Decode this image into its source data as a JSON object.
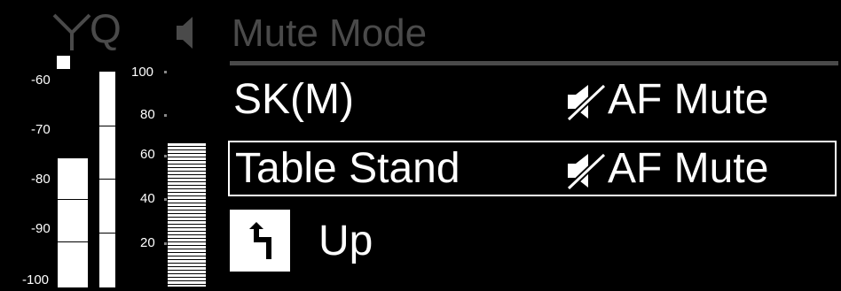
{
  "header": {
    "title": "Mute Mode",
    "icons": [
      "antenna-icon",
      "speaker-icon"
    ],
    "q_label": "Q"
  },
  "meters": {
    "rf_scale": [
      "-60",
      "-70",
      "-80",
      "-90",
      "-100"
    ],
    "af_scale": [
      "100",
      "80",
      "60",
      "40",
      "20"
    ],
    "af_level_percent": 65,
    "rf_level_dbm": -76
  },
  "menu": {
    "items": [
      {
        "label": "SK(M)",
        "value": "AF Mute",
        "value_icon": "muted-speaker-icon",
        "selected": false
      },
      {
        "label": "Table Stand",
        "value": "AF Mute",
        "value_icon": "muted-speaker-icon",
        "selected": true
      },
      {
        "label": "Up",
        "icon": "return-arrow-icon"
      }
    ]
  },
  "colors": {
    "background": "#000000",
    "foreground": "#ffffff",
    "dim": "#4a4a4a"
  }
}
